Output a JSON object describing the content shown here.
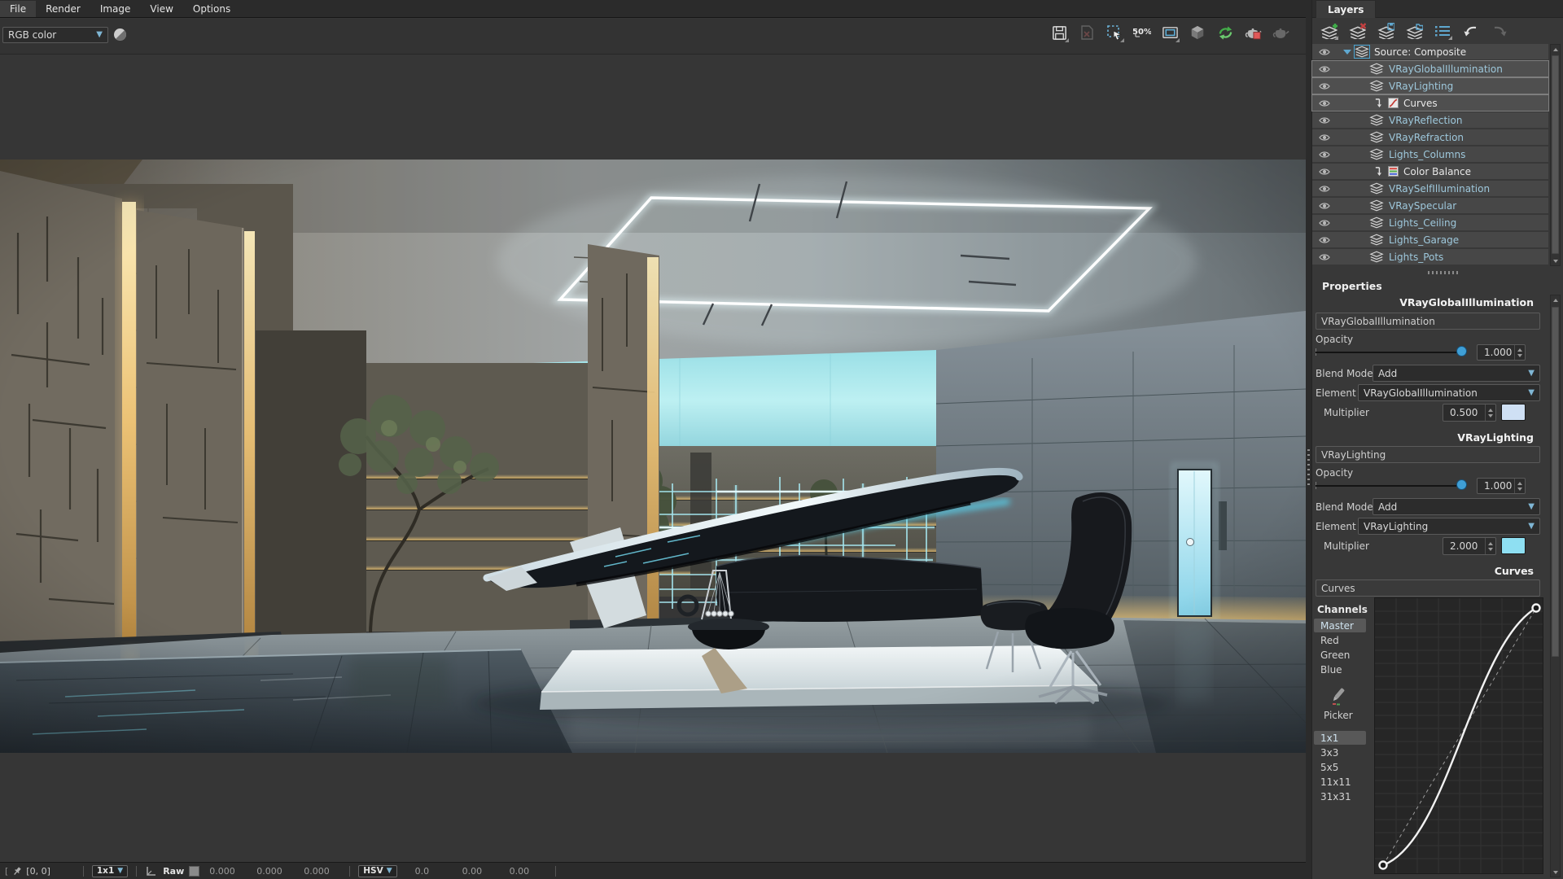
{
  "menu": {
    "items": [
      "File",
      "Render",
      "Image",
      "View",
      "Options"
    ]
  },
  "toolbar": {
    "channel_dropdown": "RGB color",
    "zoom_label": "50%",
    "icons": [
      "save-image",
      "clear-image",
      "region-render",
      "zoom-level",
      "safe-frame",
      "isolate-cube",
      "continuous-update",
      "render-last",
      "render-disabled"
    ]
  },
  "layers": {
    "tab": "Layers",
    "toolbar_icons": [
      "add-layer",
      "delete-layer",
      "save-layers",
      "load-layers",
      "layer-list",
      "undo",
      "redo"
    ],
    "tree": [
      {
        "label": "Source: Composite"
      },
      {
        "label": "VRayGlobalIllumination"
      },
      {
        "label": "VRayLighting"
      },
      {
        "label": "Curves"
      },
      {
        "label": "VRayReflection"
      },
      {
        "label": "VRayRefraction"
      },
      {
        "label": "Lights_Columns"
      },
      {
        "label": "Color Balance"
      },
      {
        "label": "VRaySelfIllumination"
      },
      {
        "label": "VRaySpecular"
      },
      {
        "label": "Lights_Ceiling"
      },
      {
        "label": "Lights_Garage"
      },
      {
        "label": "Lights_Pots"
      }
    ]
  },
  "properties": {
    "header": "Properties",
    "labels": {
      "opacity": "Opacity",
      "blend_mode": "Blend Mode",
      "element": "Element",
      "multiplier": "Multiplier"
    },
    "gi": {
      "title": "VRayGlobalIllumination",
      "name": "VRayGlobalIllumination",
      "opacity": "1.000",
      "blend_mode": "Add",
      "element": "VRayGlobalIllumination",
      "multiplier": "0.500",
      "multiplier_color": "#cfe0f4"
    },
    "lighting": {
      "title": "VRayLighting",
      "name": "VRayLighting",
      "opacity": "1.000",
      "blend_mode": "Add",
      "element": "VRayLighting",
      "multiplier": "2.000",
      "multiplier_color": "#8edff2"
    },
    "curves": {
      "title": "Curves",
      "name": "Curves",
      "channels_label": "Channels",
      "channels": [
        "Master",
        "Red",
        "Green",
        "Blue"
      ],
      "selected_channel": "Master",
      "picker_label": "Picker",
      "kernels": [
        "1x1",
        "3x3",
        "5x5",
        "11x11",
        "31x31"
      ],
      "selected_kernel": "1x1"
    }
  },
  "status": {
    "bracket": "[",
    "coords": "[0, 0]",
    "sample": "1x1",
    "raw_label": "Raw",
    "r": "0.000",
    "g": "0.000",
    "b": "0.000",
    "mode": "HSV",
    "h": "0.0",
    "s": "0.00",
    "v": "0.00"
  },
  "colors": {
    "accent_blue": "#53a6d2",
    "layer_text": "#9ec8dc",
    "swatch_gi": "#cfe0f4",
    "swatch_lighting": "#8edff2",
    "slider_handle": "#3f9fd6"
  }
}
